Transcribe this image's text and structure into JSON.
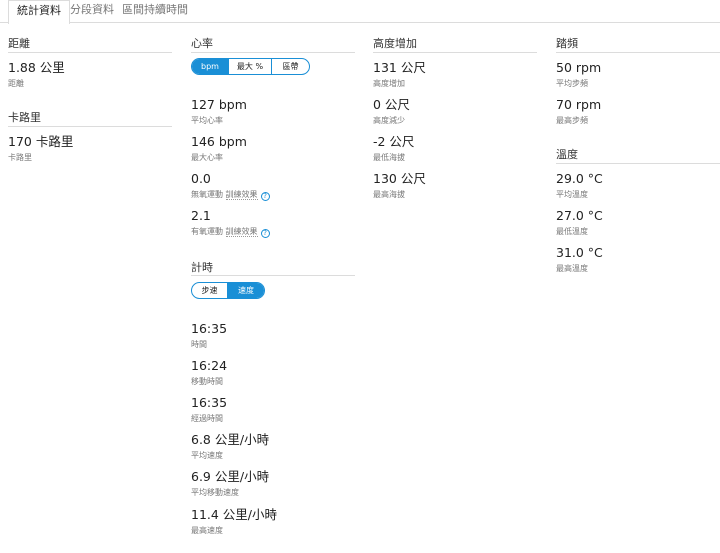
{
  "tabs": [
    "統計資料",
    "分段資料",
    "區間持續時間"
  ],
  "distance": {
    "title": "距離",
    "value": "1.88 公里",
    "label": "距離"
  },
  "calories": {
    "title": "卡路里",
    "value": "170 卡路里",
    "label": "卡路里"
  },
  "heart_rate": {
    "title": "心率",
    "toggle": [
      "bpm",
      "最大 %",
      "區帶"
    ],
    "avg": {
      "value": "127 bpm",
      "label": "平均心率"
    },
    "max": {
      "value": "146 bpm",
      "label": "最大心率"
    },
    "anaerobic": {
      "value": "0.0",
      "label_a": "無氧運動",
      "label_b": "訓練效果"
    },
    "aerobic": {
      "value": "2.1",
      "label_a": "有氧運動",
      "label_b": "訓練效果"
    },
    "help_glyph": "?"
  },
  "timing": {
    "title": "計時",
    "toggle": [
      "步速",
      "速度"
    ],
    "time": {
      "value": "16:35",
      "label": "時間"
    },
    "moving_time": {
      "value": "16:24",
      "label": "移動時間"
    },
    "elapsed_time": {
      "value": "16:35",
      "label": "經過時間"
    },
    "avg_speed": {
      "value": "6.8 公里/小時",
      "label": "平均速度"
    },
    "avg_moving_speed": {
      "value": "6.9 公里/小時",
      "label": "平均移動速度"
    },
    "max_speed": {
      "value": "11.4 公里/小時",
      "label": "最高速度"
    }
  },
  "elevation": {
    "title": "高度增加",
    "gain": {
      "value": "131 公尺",
      "label": "高度增加"
    },
    "loss": {
      "value": "0 公尺",
      "label": "高度減少"
    },
    "min": {
      "value": "-2 公尺",
      "label": "最低海拔"
    },
    "max": {
      "value": "130 公尺",
      "label": "最高海拔"
    }
  },
  "cadence": {
    "title": "踏頻",
    "avg": {
      "value": "50 rpm",
      "label": "平均步頻"
    },
    "max": {
      "value": "70 rpm",
      "label": "最高步頻"
    }
  },
  "temperature": {
    "title": "溫度",
    "avg": {
      "value": "29.0 °C",
      "label": "平均溫度"
    },
    "min": {
      "value": "27.0 °C",
      "label": "最低溫度"
    },
    "max": {
      "value": "31.0 °C",
      "label": "最高溫度"
    }
  }
}
